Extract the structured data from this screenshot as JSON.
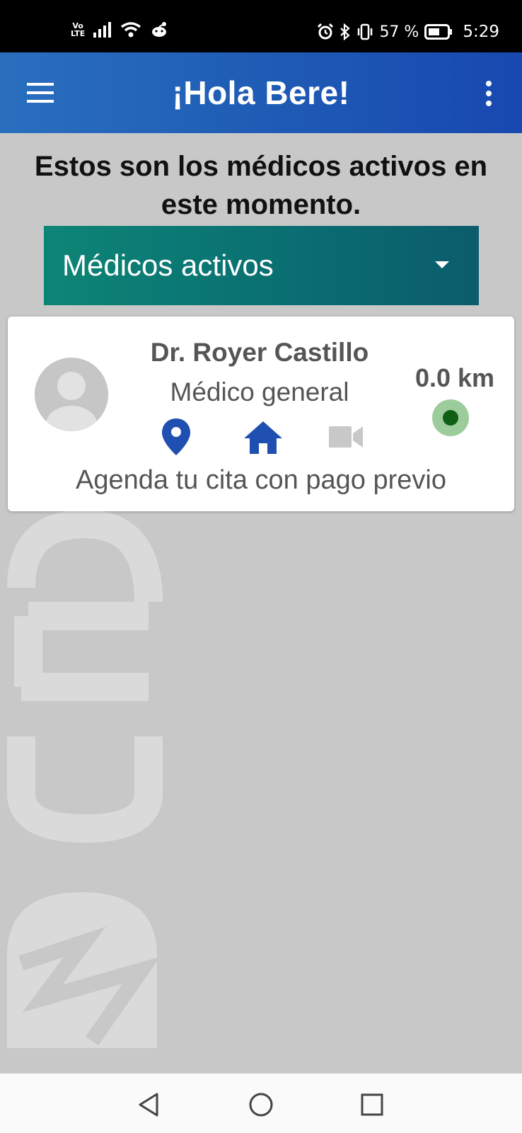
{
  "status_bar": {
    "network_label": "Vo LTE",
    "battery_percent": "57 %",
    "time": "5:29"
  },
  "app_bar": {
    "title": "¡Hola Bere!",
    "menu_icon": "hamburger-menu-icon",
    "overflow_icon": "more-vert-icon",
    "gradient_colors": [
      "#2a6fbf",
      "#1848b0"
    ]
  },
  "page": {
    "heading": "Estos son los médicos activos en este momento."
  },
  "filter": {
    "selected": "Médicos activos",
    "icon": "caret-down-icon",
    "gradient_colors": [
      "#0d8575",
      "#0b5c6c"
    ]
  },
  "doctors": [
    {
      "name": "Dr. Royer Castillo",
      "specialty": "Médico general",
      "distance": "0.0 km",
      "online": true,
      "services": {
        "location": {
          "icon": "location-pin-icon",
          "active": true
        },
        "home_visit": {
          "icon": "home-icon",
          "active": true
        },
        "video_call": {
          "icon": "video-camera-icon",
          "active": false
        }
      },
      "cta": "Agenda tu cita con pago previo"
    }
  ],
  "colors": {
    "active_icon": "#1f4fb0",
    "inactive_icon": "#c8c8c8",
    "online_dot": "#0f5e14",
    "online_ring": "#9ccc9c",
    "background": "#c8c8c8"
  },
  "nav_bar": {
    "back_icon": "back-triangle-icon",
    "home_icon": "home-circle-icon",
    "recents_icon": "recents-square-icon"
  }
}
